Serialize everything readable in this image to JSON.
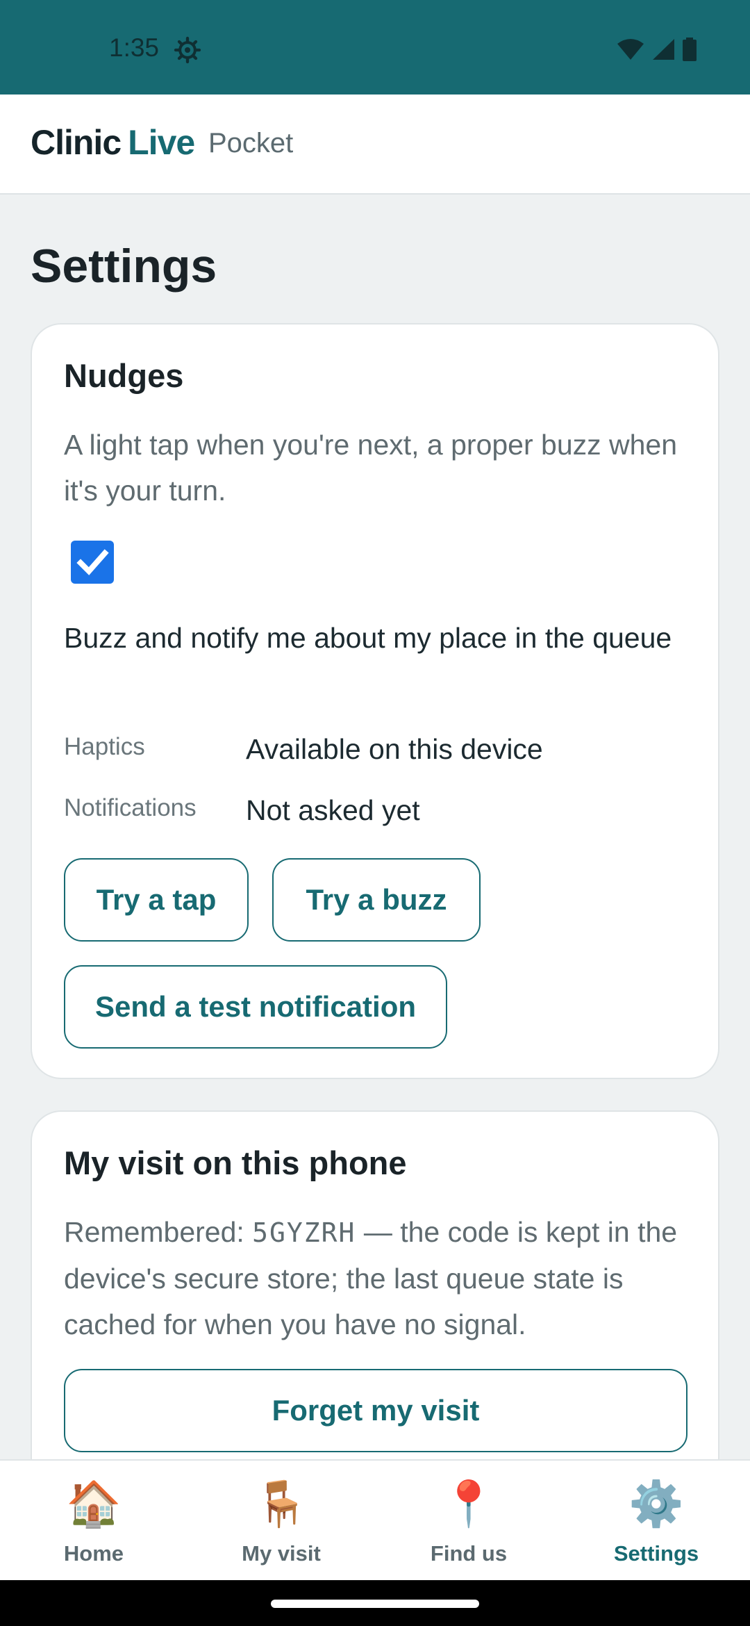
{
  "status_bar": {
    "time": "1:35",
    "icons": [
      "settings-gear-icon",
      "wifi-icon",
      "signal-icon",
      "battery-icon"
    ]
  },
  "header": {
    "brand_part1": "Clinic",
    "brand_part2": "Live",
    "brand_suffix": "Pocket"
  },
  "page": {
    "title": "Settings"
  },
  "nudges": {
    "title": "Nudges",
    "description": "A light tap when you're next, a proper buzz when it's your turn.",
    "checkbox_checked": true,
    "checkbox_label": "Buzz and notify me about my place in the queue",
    "haptics_key": "Haptics",
    "haptics_value": "Available on this device",
    "notifications_key": "Notifications",
    "notifications_value": "Not asked yet",
    "try_tap_label": "Try a tap",
    "try_buzz_label": "Try a buzz",
    "test_notification_label": "Send a test notification"
  },
  "visit": {
    "title": "My visit on this phone",
    "remembered_prefix": "Remembered: ",
    "code": "5GYZRH",
    "remembered_suffix": " — the code is kept in the device's secure store; the last queue state is cached for when you have no signal.",
    "forget_label": "Forget my visit"
  },
  "bottom_nav": {
    "items": [
      {
        "label": "Home",
        "icon": "🏠",
        "icon_name": "house-icon",
        "active": false
      },
      {
        "label": "My visit",
        "icon": "🪑",
        "icon_name": "chair-icon",
        "active": false
      },
      {
        "label": "Find us",
        "icon": "📍",
        "icon_name": "map-pin-icon",
        "active": false
      },
      {
        "label": "Settings",
        "icon": "⚙️",
        "icon_name": "gear-icon",
        "active": true
      }
    ]
  },
  "colors": {
    "brand": "#176a72",
    "checkbox": "#1a73e8",
    "status_bar": "#176a72"
  }
}
